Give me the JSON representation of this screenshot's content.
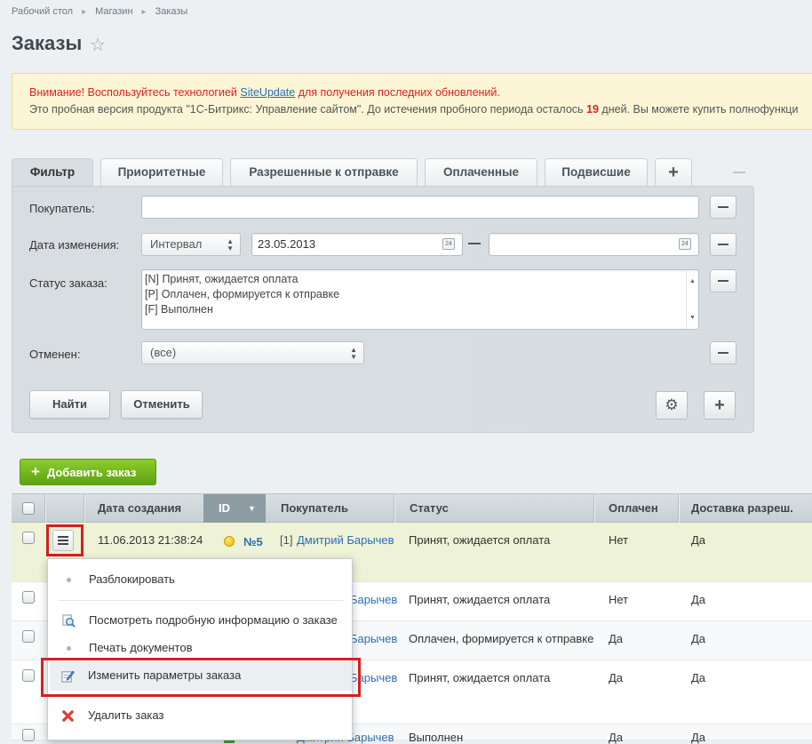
{
  "breadcrumbs": [
    "Рабочий стол",
    "Магазин",
    "Заказы"
  ],
  "page_title": "Заказы",
  "notice": {
    "warn_prefix": "Внимание! Воспользуйтесь технологией ",
    "warn_link": "SiteUpdate",
    "warn_suffix": " для получения последних обновлений.",
    "trial_prefix": "Это пробная версия продукта \"1С-Битрикс: Управление сайтом\". До истечения пробного периода осталось ",
    "trial_days": "19",
    "trial_suffix": " дней. Вы можете купить полнофункци"
  },
  "filter_tabs": [
    "Фильтр",
    "Приоритетные",
    "Разрешенные к отправке",
    "Оплаченные",
    "Подвисшие"
  ],
  "filter": {
    "buyer_label": "Покупатель:",
    "buyer_value": "",
    "date_label": "Дата изменения:",
    "date_mode": "Интервал",
    "date_from": "23.05.2013",
    "date_to": "",
    "calendar_day": "24",
    "status_label": "Статус заказа:",
    "status_options": [
      "[N] Принят, ожидается оплата",
      "[P] Оплачен, формируется к отправке",
      "[F] Выполнен"
    ],
    "canceled_label": "Отменен:",
    "canceled_value": "(все)",
    "find_button": "Найти",
    "cancel_button": "Отменить"
  },
  "add_order_button": "Добавить заказ",
  "table": {
    "columns": [
      "Дата создания",
      "ID",
      "Покупатель",
      "Статус",
      "Оплачен",
      "Доставка разреш."
    ],
    "rows": [
      {
        "date": "11.06.2013 21:38:24",
        "id": "№5",
        "buyer_id": "[1]",
        "buyer": "Дмитрий Барычев",
        "status": "Принят, ожидается оплата",
        "paid": "Нет",
        "delivery": "Да"
      },
      {
        "buyer_tail": "Барычев",
        "status": "Принят, ожидается оплата",
        "paid": "Нет",
        "delivery": "Да"
      },
      {
        "buyer_tail": "Барычев",
        "status": "Оплачен, формируется к отправке",
        "paid": "Да",
        "delivery": "Да"
      },
      {
        "buyer_tail": "Барычев",
        "status": "Принят, ожидается оплата",
        "paid": "Да",
        "delivery": "Да"
      },
      {
        "buyer_tail": "Дмитрий Барычев",
        "status": "Выполнен",
        "paid": "Да",
        "delivery": "Да"
      }
    ]
  },
  "context_menu": {
    "unlock": "Разблокировать",
    "view_details": "Посмотреть подробную информацию о заказе",
    "print_docs": "Печать документов",
    "edit_params": "Изменить параметры заказа",
    "delete_order": "Удалить заказ"
  },
  "colors": {
    "accent_red": "#d52020",
    "link_blue": "#2a6fb5",
    "add_green": "#6cb21a"
  }
}
